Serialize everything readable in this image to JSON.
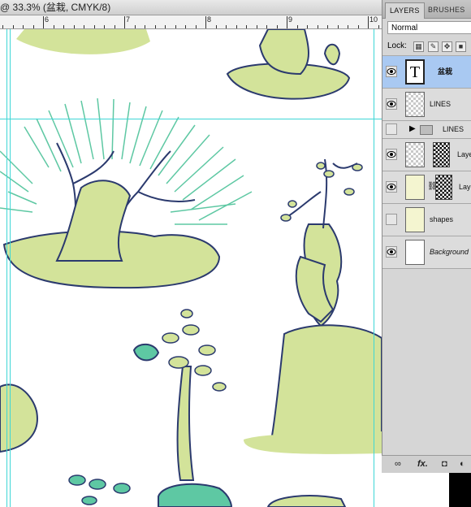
{
  "window": {
    "title": "@ 33.3% (盆栽, CMYK/8)"
  },
  "ruler": {
    "labels": [
      "6",
      "7",
      "8",
      "9",
      "10"
    ]
  },
  "panel": {
    "tabs": [
      {
        "label": "LAYERS",
        "active": true
      },
      {
        "label": "BRUSHES",
        "active": false
      }
    ],
    "blend_mode": "Normal",
    "lock_label": "Lock:",
    "layers": [
      {
        "name": "盆栽",
        "type": "text",
        "visible": true,
        "selected": true
      },
      {
        "name": "LINES",
        "type": "raster",
        "visible": true,
        "selected": false
      },
      {
        "name": "LINES",
        "type": "group",
        "visible": false,
        "selected": false
      },
      {
        "name": "Laye",
        "type": "masked",
        "visible": true,
        "selected": false
      },
      {
        "name": "Lay",
        "type": "masked-linked",
        "visible": true,
        "selected": false
      },
      {
        "name": "shapes",
        "type": "raster",
        "visible": false,
        "selected": false
      },
      {
        "name": "Background",
        "type": "background",
        "visible": true,
        "selected": false
      }
    ],
    "footer_icons": [
      "link-icon",
      "fx-icon",
      "mask-icon",
      "adjustment-icon"
    ],
    "footer_fx": "fx."
  },
  "colors": {
    "plant_fill": "#d3e39a",
    "line": "#2b3a6e",
    "foliage": "#5ec8a3",
    "guide": "#3ed6d6",
    "selection": "#a9c9f2"
  }
}
